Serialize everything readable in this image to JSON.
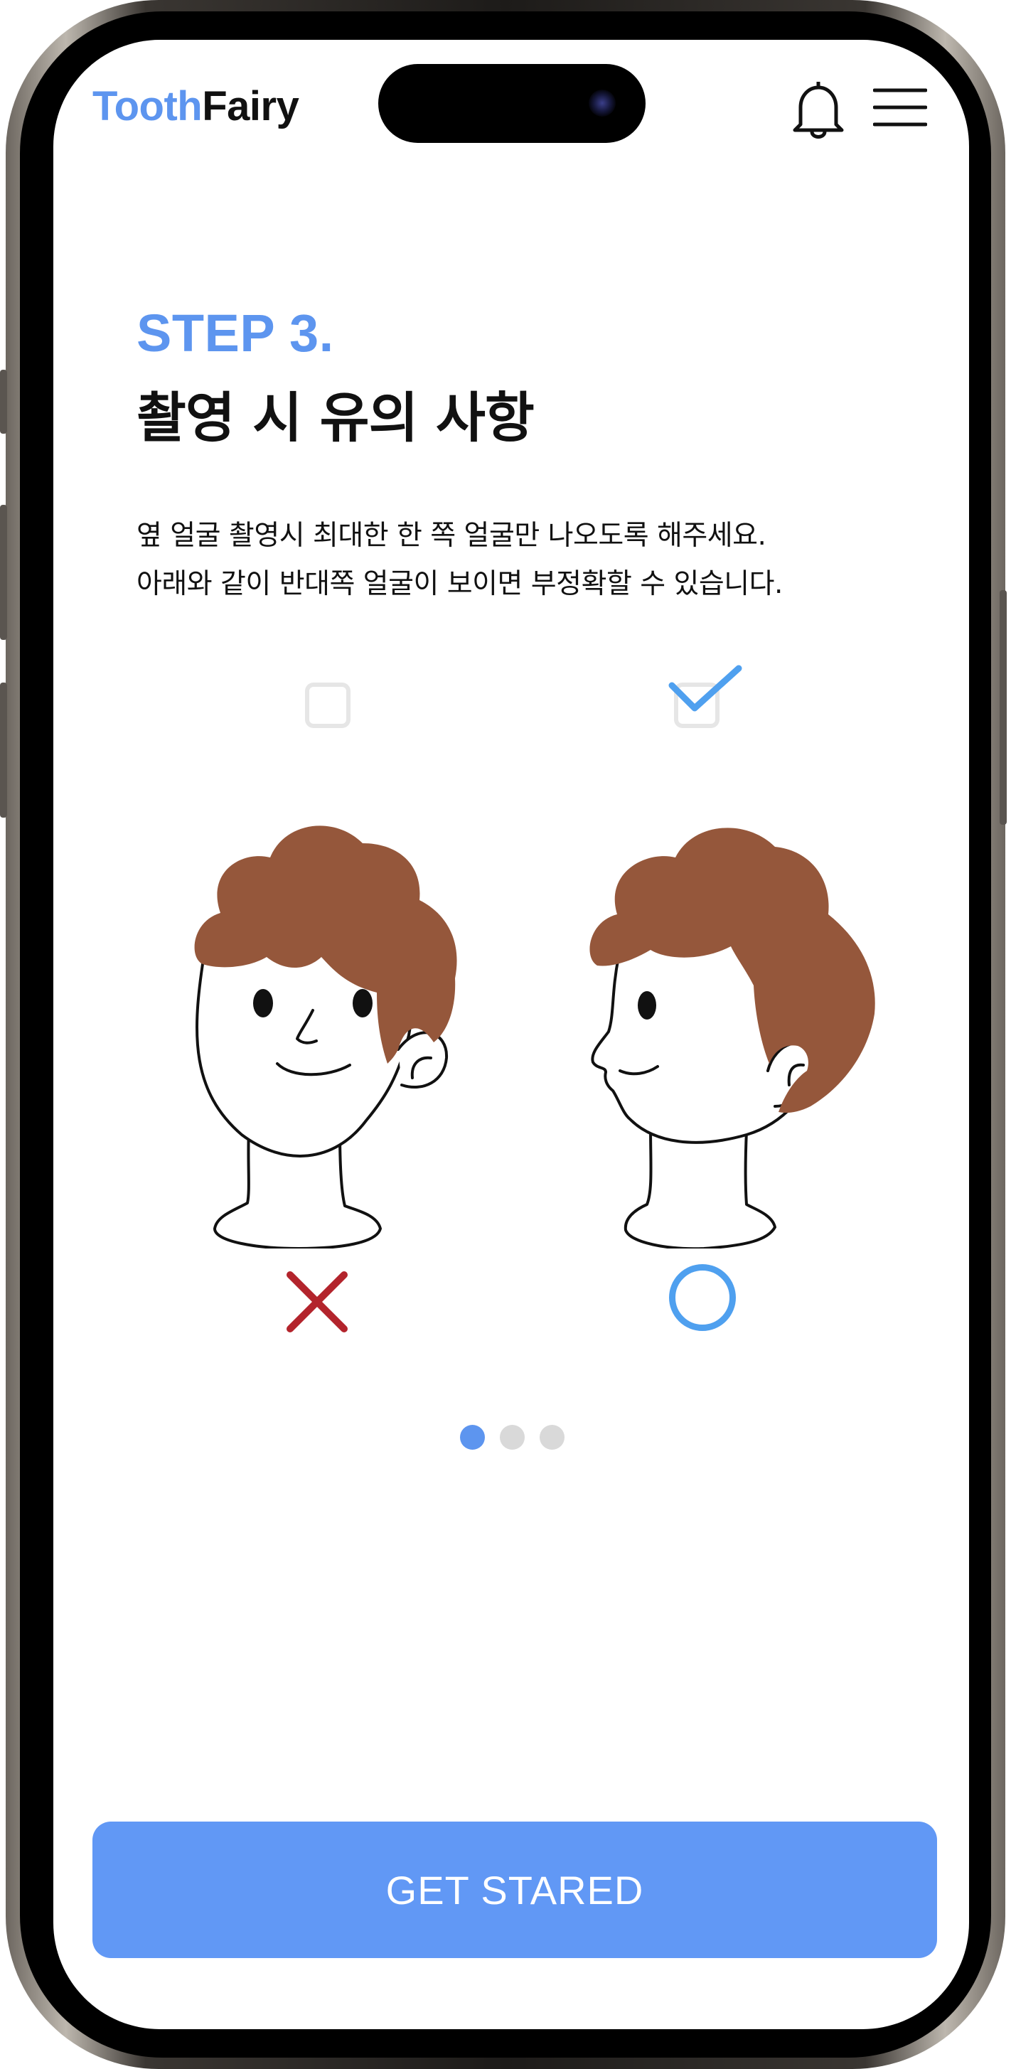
{
  "header": {
    "logo_part1": "Tooth",
    "logo_part2": "Fairy",
    "icons": [
      "bell-icon",
      "hamburger-menu-icon"
    ]
  },
  "content": {
    "step_label": "STEP 3.",
    "title": "촬영 시 유의 사항",
    "description_lines": [
      "옆 얼굴 촬영시 최대한 한 쪽 얼굴만 나오도록 해주세요.",
      "아래와 같이 반대쪽 얼굴이 보이면 부정확할 수 있습니다."
    ]
  },
  "examples": [
    {
      "name": "three-quarter-face",
      "selected": false,
      "result_icon": "cross-icon",
      "result_color": "#b3242c"
    },
    {
      "name": "side-profile-face",
      "selected": true,
      "result_icon": "circle-icon",
      "result_color": "#4fa0ef"
    }
  ],
  "pagination": {
    "total": 3,
    "current": 1
  },
  "cta": {
    "label": "GET STARED"
  },
  "colors": {
    "brand": "#5d95ef",
    "button": "#6198f5",
    "hair": "#95573b",
    "check": "#4fa0ef",
    "wrong": "#b3242c",
    "dot_inactive": "#d9d9d9"
  }
}
